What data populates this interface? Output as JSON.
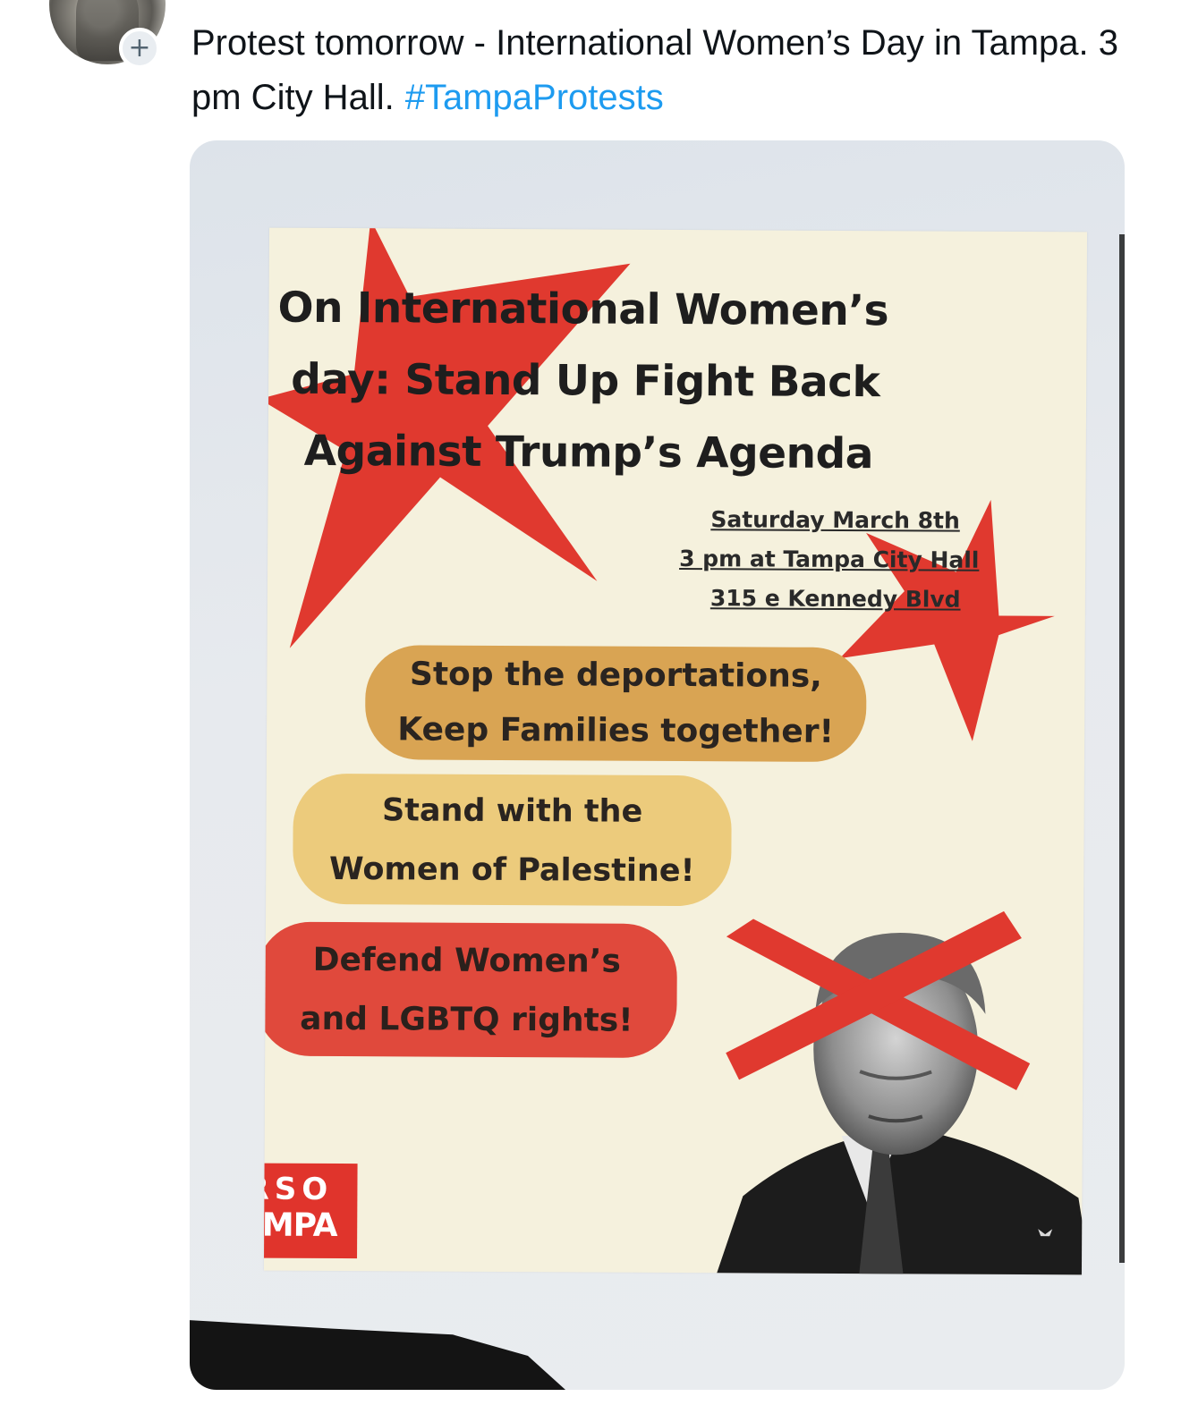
{
  "post": {
    "text": "Protest tomorrow - International Women’s Day in Tampa. 3 pm City Hall.",
    "hashtag": "#TampaProtests",
    "follow_glyph": "+"
  },
  "flyer": {
    "headline": [
      "On International Women’s",
      "day: Stand Up Fight Back",
      "Against Trump’s Agenda"
    ],
    "event": [
      "Saturday March 8th",
      "3 pm at Tampa City Hall",
      "315 e Kennedy Blvd"
    ],
    "slogans": [
      [
        "Stop the deportations,",
        "Keep Families together!"
      ],
      [
        "Stand with the",
        "Women of Palestine!"
      ],
      [
        "Defend Women’s",
        "and LGBTQ rights!"
      ]
    ],
    "logo": [
      "FRSO",
      "TAMPA"
    ]
  },
  "colors": {
    "hashtag": "#1d9bf0",
    "star_red": "#e0392f",
    "pill_orange": "#d9a453",
    "pill_yellow": "#eccb7c",
    "pill_red": "#e0493c"
  },
  "icons": [
    "plus-icon",
    "star-icon",
    "x-mark-icon"
  ]
}
